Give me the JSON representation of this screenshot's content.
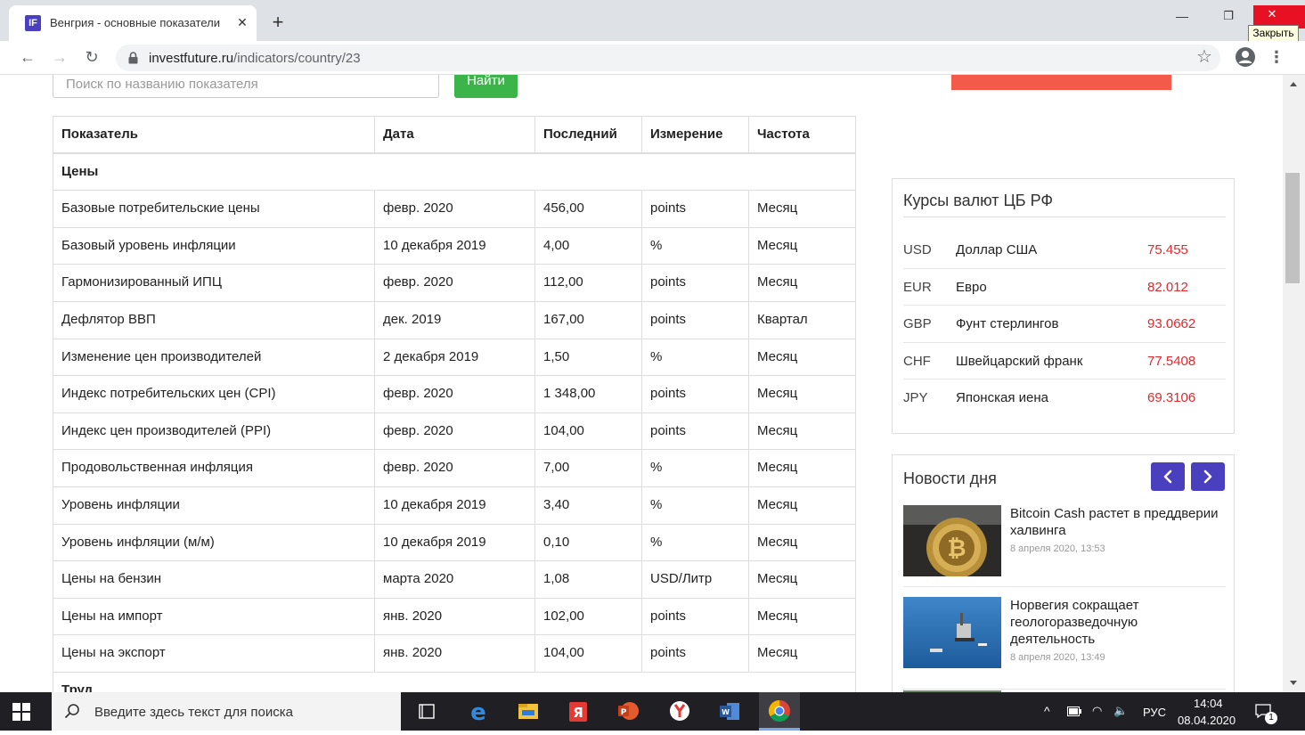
{
  "browser": {
    "tab_title": "Венгрия - основные показатели",
    "tab_close": "✕",
    "new_tab": "+",
    "close_tooltip": "Закрыть",
    "url_domain": "investfuture.ru",
    "url_path": "/indicators/country/23"
  },
  "search": {
    "placeholder": "Поиск по названию показателя",
    "button": "Найти"
  },
  "table": {
    "headers": [
      "Показатель",
      "Дата",
      "Последний",
      "Измерение",
      "Частота"
    ],
    "groups": [
      {
        "name": "Цены",
        "rows": [
          [
            "Базовые потребительские цены",
            "февр. 2020",
            "456,00",
            "points",
            "Месяц"
          ],
          [
            "Базовый уровень инфляции",
            "10 декабря 2019",
            "4,00",
            "%",
            "Месяц"
          ],
          [
            "Гармонизированный ИПЦ",
            "февр. 2020",
            "112,00",
            "points",
            "Месяц"
          ],
          [
            "Дефлятор ВВП",
            "дек. 2019",
            "167,00",
            "points",
            "Квартал"
          ],
          [
            "Изменение цен производителей",
            "2 декабря 2019",
            "1,50",
            "%",
            "Месяц"
          ],
          [
            "Индекс потребительских цен (CPI)",
            "февр. 2020",
            "1 348,00",
            "points",
            "Месяц"
          ],
          [
            "Индекс цен производителей (PPI)",
            "февр. 2020",
            "104,00",
            "points",
            "Месяц"
          ],
          [
            "Продовольственная инфляция",
            "февр. 2020",
            "7,00",
            "%",
            "Месяц"
          ],
          [
            "Уровень инфляции",
            "10 декабря 2019",
            "3,40",
            "%",
            "Месяц"
          ],
          [
            "Уровень инфляции (м/м)",
            "10 декабря 2019",
            "0,10",
            "%",
            "Месяц"
          ],
          [
            "Цены на бензин",
            "марта 2020",
            "1,08",
            "USD/Литр",
            "Месяц"
          ],
          [
            "Цены на импорт",
            "янв. 2020",
            "102,00",
            "points",
            "Месяц"
          ],
          [
            "Цены на экспорт",
            "янв. 2020",
            "104,00",
            "points",
            "Месяц"
          ]
        ]
      },
      {
        "name": "Труд",
        "rows": []
      }
    ]
  },
  "rates": {
    "title": "Курсы валют ЦБ РФ",
    "items": [
      {
        "code": "USD",
        "name": "Доллар США",
        "value": "75.455"
      },
      {
        "code": "EUR",
        "name": "Евро",
        "value": "82.012"
      },
      {
        "code": "GBP",
        "name": "Фунт стерлингов",
        "value": "93.0662"
      },
      {
        "code": "CHF",
        "name": "Швейцарский франк",
        "value": "77.5408"
      },
      {
        "code": "JPY",
        "name": "Японская иена",
        "value": "69.3106"
      }
    ]
  },
  "news": {
    "title": "Новости дня",
    "items": [
      {
        "title": "Bitcoin Cash растет в преддверии халвинга",
        "date": "8 апреля 2020, 13:53"
      },
      {
        "title": "Норвегия сокращает геологоразведочную деятельность",
        "date": "8 апреля 2020, 13:49"
      }
    ]
  },
  "taskbar": {
    "search_placeholder": "Введите здесь текст для поиска",
    "lang": "РУС",
    "time": "14:04",
    "date": "08.04.2020",
    "notifications": "1"
  },
  "colors": {
    "accent": "#4a3fbf",
    "search_button": "#3bb54a",
    "rate_value": "#e0292b",
    "banner": "#f45a4a"
  }
}
